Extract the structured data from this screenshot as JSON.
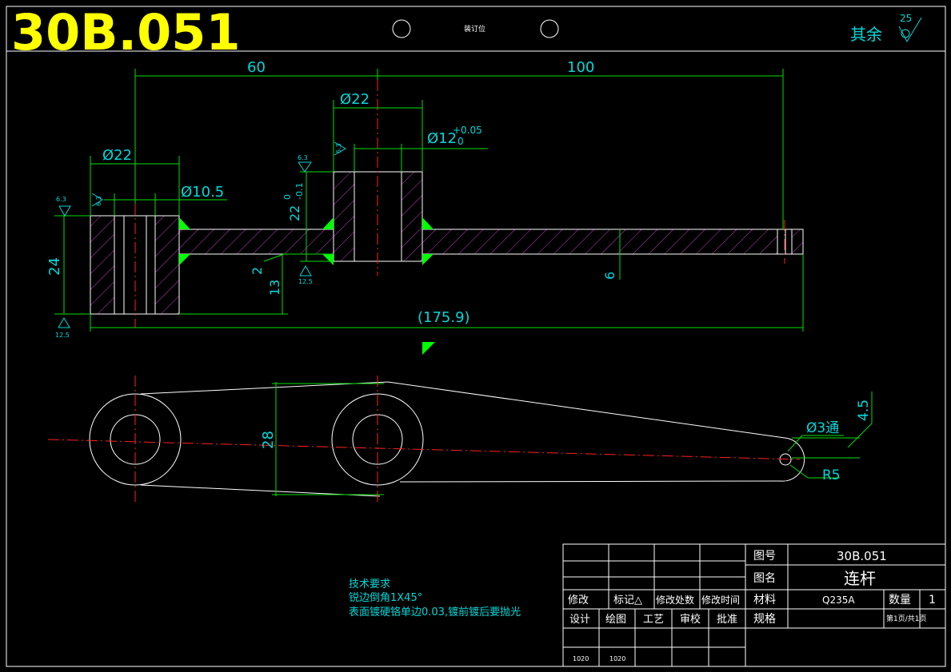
{
  "drawing_number_title": "30B.051",
  "binding_label": "装订位",
  "roughness": {
    "others_label": "其余",
    "others_value": "25",
    "r6_3": "6.3",
    "r12_5": "12.5"
  },
  "dimensions": {
    "d60": "60",
    "d100": "100",
    "phi22_left": "Ø22",
    "phi22_mid": "Ø22",
    "phi12": "Ø12",
    "phi12_up": "+0.05",
    "phi12_low": "0",
    "phi10_5": "Ø10.5",
    "d24": "24",
    "d22": "22",
    "d22_up": "0",
    "d22_low": "-0.1",
    "d2": "2",
    "d13": "13",
    "d6": "6",
    "d175_9": "(175.9)",
    "d28": "28",
    "d4_5": "4.5",
    "phi3": "Ø3通",
    "r5": "R5"
  },
  "tech": {
    "heading": "技术要求",
    "line1": "锐边倒角1X45°",
    "line2": "表面镀硬铬单边0.03,镀前镀后要抛光"
  },
  "title_block": {
    "label_drawing_no": "图号",
    "drawing_no": "30B.051",
    "label_name": "图名",
    "name": "连杆",
    "label_material": "材料",
    "material": "Q235A",
    "label_qty": "数量",
    "qty": "1",
    "label_spec": "规格",
    "page": "第1页/共1页",
    "rev_headers": [
      "修改",
      "标记△",
      "修改处数",
      "修改时间"
    ],
    "sign_headers": [
      "设计",
      "绘图",
      "工艺",
      "审校",
      "批准"
    ],
    "sign_values": [
      "1020",
      "1020"
    ]
  }
}
